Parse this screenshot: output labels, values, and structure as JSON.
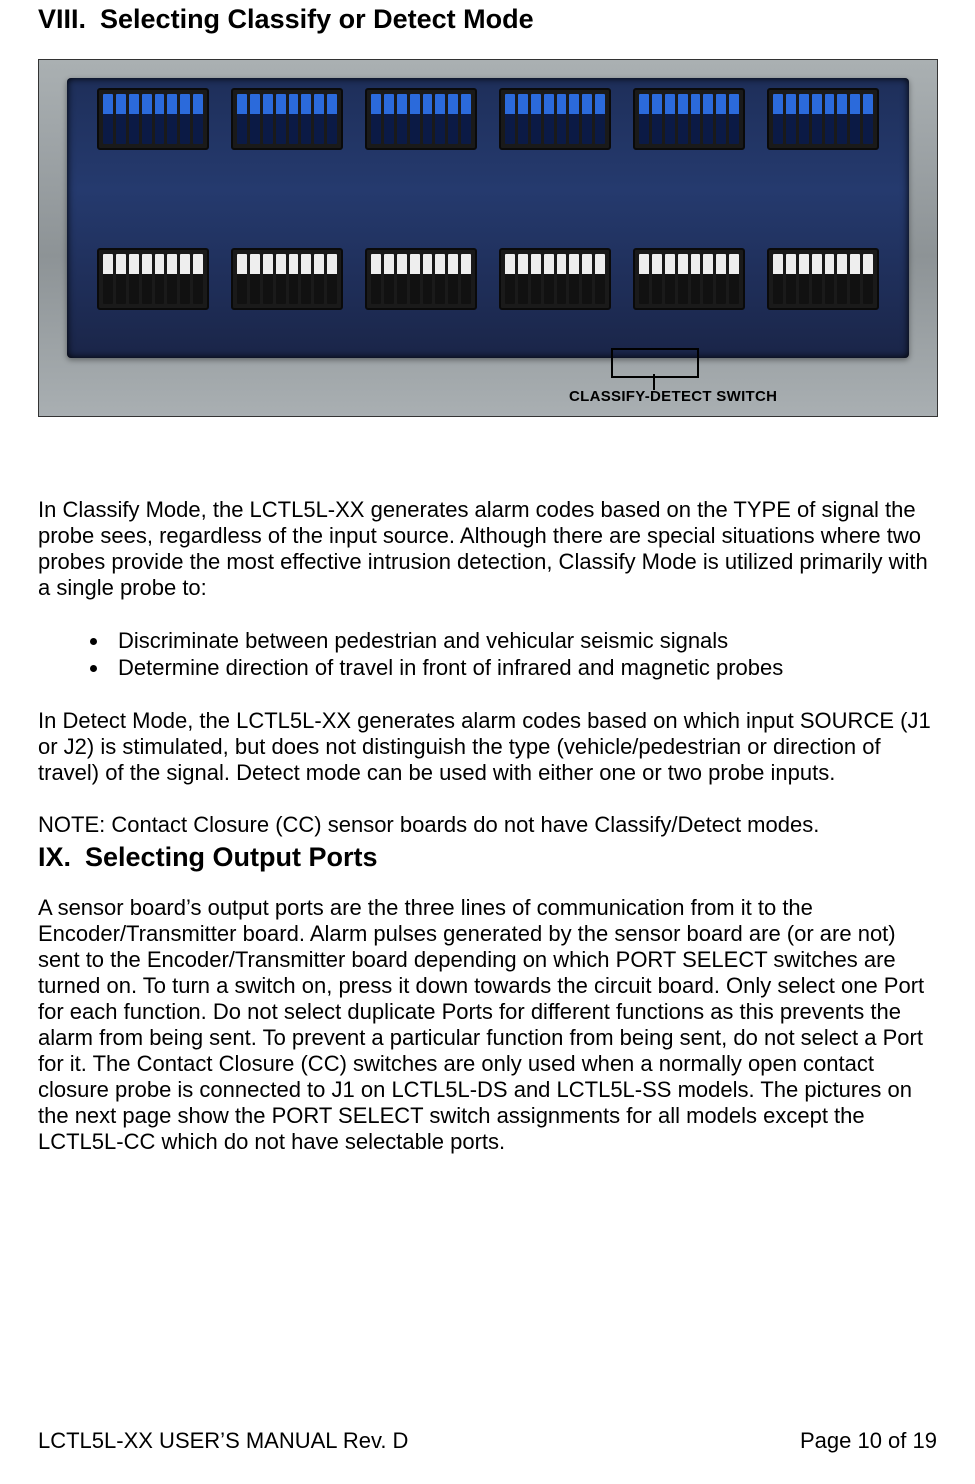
{
  "section8": {
    "num": "VIII.",
    "title": "Selecting Classify or Detect Mode",
    "figure_label": "CLASSIFY-DETECT SWITCH",
    "para1": "In Classify Mode, the LCTL5L-XX generates alarm codes based on the TYPE of signal the probe sees, regardless of the input source.  Although there are special situations where two probes provide the most effective intrusion detection, Classify Mode is utilized primarily with a single probe to:",
    "bullets": [
      "Discriminate between pedestrian and vehicular seismic signals",
      "Determine direction of travel in front of infrared and magnetic probes"
    ],
    "para2": "In Detect Mode, the LCTL5L-XX generates alarm codes based on which input SOURCE (J1 or J2) is stimulated, but does not distinguish the type (vehicle/pedestrian or direction of travel) of the signal.  Detect mode can be used with either one or two probe inputs.",
    "note": "NOTE:  Contact Closure (CC) sensor boards do not have Classify/Detect modes."
  },
  "section9": {
    "num": "IX.",
    "title": "Selecting Output Ports",
    "para1": "A sensor board’s output ports are the three lines of communication from it to the Encoder/Transmitter board.  Alarm pulses generated by the sensor board are (or are not) sent to the Encoder/Transmitter board depending on which PORT SELECT switches are turned on.  To turn a switch on, press it down towards the circuit board.  Only select one Port for each function.  Do not select duplicate Ports for different functions as this prevents the alarm from being sent.  To prevent a particular function from being sent, do not select a Port for it.  The Contact Closure (CC) switches are only used when a normally open contact closure probe is connected to J1 on LCTL5L-DS and LCTL5L-SS models.  The pictures on the next page show the PORT SELECT switch assignments for all models except the LCTL5L-CC which do not have selectable ports."
  },
  "footer": {
    "left": "LCTL5L-XX USER’S MANUAL Rev. D",
    "right": "Page 10 of 19"
  }
}
